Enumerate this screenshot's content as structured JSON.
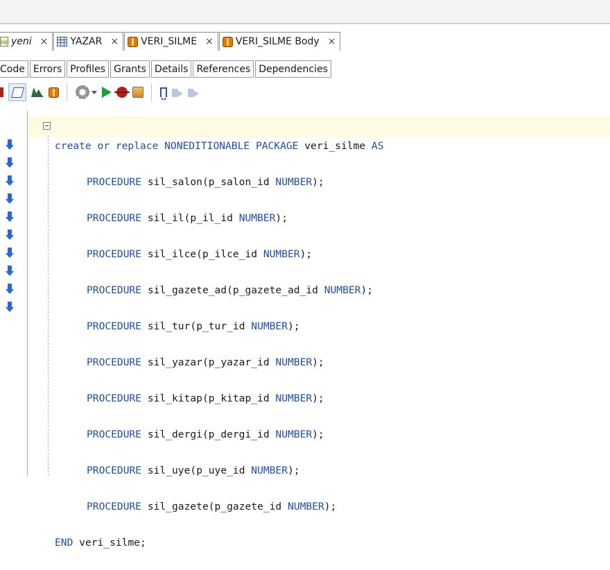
{
  "editor_tabs": [
    {
      "label": "yeni",
      "icon": "sql-worksheet-icon",
      "italic": true
    },
    {
      "label": "YAZAR",
      "icon": "table-icon",
      "italic": false
    },
    {
      "label": "VERI_SILME",
      "icon": "package-icon",
      "italic": false
    },
    {
      "label": "VERI_SILME Body",
      "icon": "package-body-icon",
      "italic": false
    }
  ],
  "tab_close_glyph": "×",
  "sub_tabs": [
    "Code",
    "Errors",
    "Profiles",
    "Grants",
    "Details",
    "References",
    "Dependencies"
  ],
  "toolbar_icons": [
    "refresh-icon",
    "edit-icon",
    "compile-icon",
    "package-icon",
    "settings-icon",
    "run-icon",
    "debug-icon",
    "profile-icon",
    "toggle-bookmark-icon",
    "next-bookmark-icon",
    "previous-bookmark-icon"
  ],
  "code": {
    "header": {
      "kw1": "create or replace NONEDITIONABLE PACKAGE",
      "name": "veri_silme",
      "kw2": "AS"
    },
    "procedures": [
      {
        "kw": "PROCEDURE",
        "name": "sil_salon",
        "param": "p_salon_id",
        "type": "NUMBER"
      },
      {
        "kw": "PROCEDURE",
        "name": "sil_il",
        "param": "p_il_id",
        "type": "NUMBER"
      },
      {
        "kw": "PROCEDURE",
        "name": "sil_ilce",
        "param": "p_ilce_id",
        "type": "NUMBER"
      },
      {
        "kw": "PROCEDURE",
        "name": "sil_gazete_ad",
        "param": "p_gazete_ad_id",
        "type": "NUMBER"
      },
      {
        "kw": "PROCEDURE",
        "name": "sil_tur",
        "param": "p_tur_id",
        "type": "NUMBER"
      },
      {
        "kw": "PROCEDURE",
        "name": "sil_yazar",
        "param": "p_yazar_id",
        "type": "NUMBER"
      },
      {
        "kw": "PROCEDURE",
        "name": "sil_kitap",
        "param": "p_kitap_id",
        "type": "NUMBER"
      },
      {
        "kw": "PROCEDURE",
        "name": "sil_dergi",
        "param": "p_dergi_id",
        "type": "NUMBER"
      },
      {
        "kw": "PROCEDURE",
        "name": "sil_uye",
        "param": "p_uye_id",
        "type": "NUMBER"
      },
      {
        "kw": "PROCEDURE",
        "name": "sil_gazete",
        "param": "p_gazete_id",
        "type": "NUMBER"
      }
    ],
    "footer": {
      "kw": "END",
      "name": "veri_silme;"
    }
  },
  "colors": {
    "keyword": "#1d4fa6",
    "current_line": "#fffbe3",
    "implementation_marker": "#2a66d9"
  }
}
